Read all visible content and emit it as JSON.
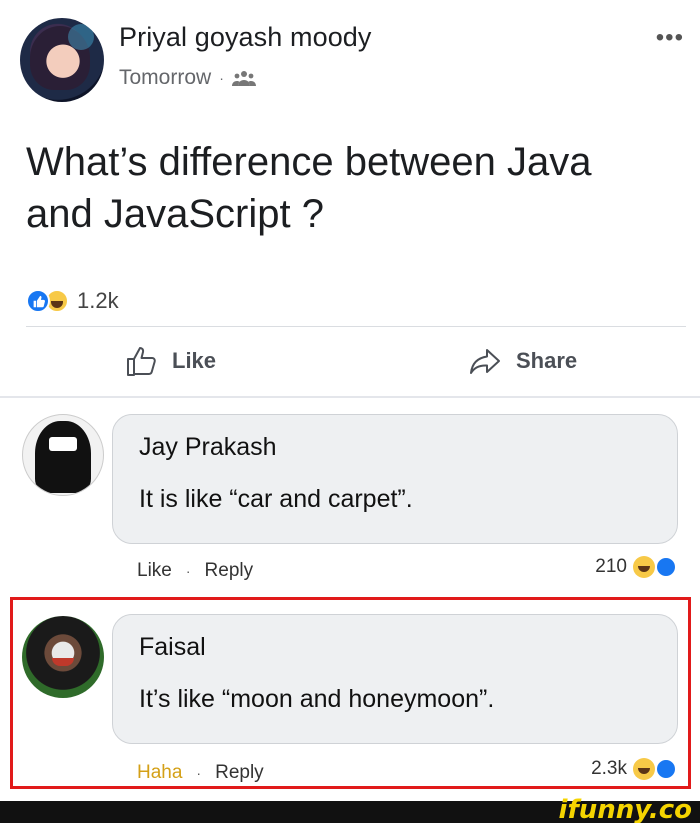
{
  "post": {
    "author": "Priyal goyash moody",
    "time": "Tomorrow",
    "separator": "·",
    "more_label": "•••",
    "text_line1": "What’s difference between Java",
    "text_line2": "and JavaScript ?",
    "reaction_count": "1.2k",
    "reaction_icons": [
      "like-reaction-icon",
      "haha-reaction-icon"
    ]
  },
  "actions": {
    "like_label": "Like",
    "share_label": "Share"
  },
  "comments": [
    {
      "name": "Jay Prakash",
      "text": "It is like “car and carpet”.",
      "action1": "Like",
      "action2": "Reply",
      "count": "210"
    },
    {
      "name": "Faisal",
      "text": "It’s like “moon and honeymoon”.",
      "action1": "Haha",
      "action2": "Reply",
      "count": "2.3k"
    }
  ],
  "watermark": "ifunny.co",
  "colors": {
    "facebook_blue": "#1877f2",
    "haha_yellow": "#f7c947",
    "highlight_red": "#e11a1a",
    "haha_text": "#d4a017"
  }
}
